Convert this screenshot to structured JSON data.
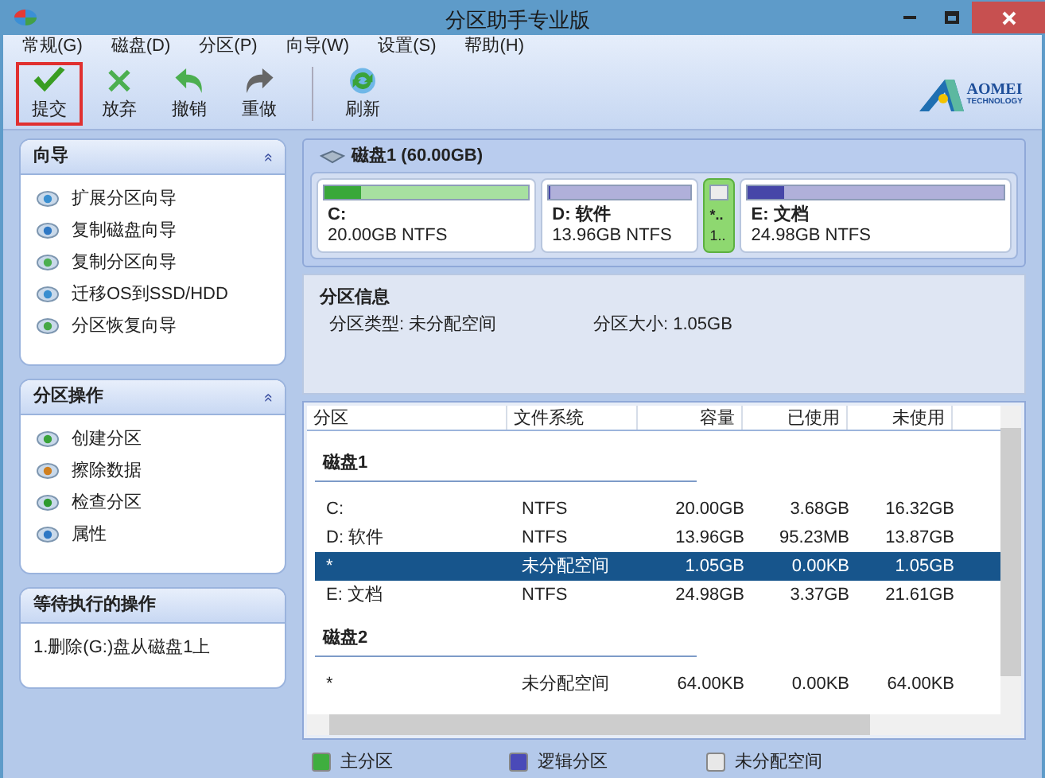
{
  "window": {
    "title": "分区助手专业版"
  },
  "menu": [
    "常规(G)",
    "磁盘(D)",
    "分区(P)",
    "向导(W)",
    "设置(S)",
    "帮助(H)"
  ],
  "toolbar": [
    {
      "label": "提交",
      "kind": "apply",
      "selected": true
    },
    {
      "label": "放弃",
      "kind": "discard",
      "selected": false
    },
    {
      "label": "撤销",
      "kind": "undo",
      "selected": false
    },
    {
      "label": "重做",
      "kind": "redo",
      "selected": false
    },
    {
      "label": "刷新",
      "kind": "refresh",
      "selected": false
    }
  ],
  "logo": {
    "name": "AOMEI",
    "tagline": "TECHNOLOGY"
  },
  "sidebar": [
    {
      "title": "向导",
      "collapse": "«",
      "items": [
        {
          "label": "扩展分区向导",
          "kind": "extend"
        },
        {
          "label": "复制磁盘向导",
          "kind": "copydisk"
        },
        {
          "label": "复制分区向导",
          "kind": "copypart"
        },
        {
          "label": "迁移OS到SSD/HDD",
          "kind": "migrate"
        },
        {
          "label": "分区恢复向导",
          "kind": "recover"
        }
      ]
    },
    {
      "title": "分区操作",
      "collapse": "«",
      "items": [
        {
          "label": "创建分区",
          "kind": "create"
        },
        {
          "label": "擦除数据",
          "kind": "wipe"
        },
        {
          "label": "检查分区",
          "kind": "check"
        },
        {
          "label": "属性",
          "kind": "info"
        }
      ]
    },
    {
      "title": "等待执行的操作",
      "items": [
        {
          "label": "1.删除(G:)盘从磁盘1上",
          "kind": "text"
        }
      ]
    }
  ],
  "disk_map": {
    "title": "磁盘1 (60.00GB)",
    "partitions": [
      {
        "name": "C:",
        "detail": "20.00GB NTFS",
        "kind": "primary",
        "level": 0.18,
        "selected": false
      },
      {
        "name": "D: 软件",
        "detail": "13.96GB NTFS",
        "kind": "logical",
        "level": 0.01,
        "selected": false
      },
      {
        "name": "*..",
        "detail": "1..",
        "kind": "unallocated",
        "selected": true
      },
      {
        "name": "E: 文档",
        "detail": "24.98GB NTFS",
        "kind": "logical",
        "level": 0.14,
        "selected": false
      }
    ]
  },
  "partition_info": {
    "title": "分区信息",
    "type": "分区类型: 未分配空间",
    "size": "分区大小: 1.05GB"
  },
  "table": {
    "columns": [
      "分区",
      "文件系统",
      "容量",
      "已使用",
      "未使用"
    ],
    "groups": [
      {
        "name": "磁盘1",
        "rows": [
          {
            "cells": [
              "C:",
              "NTFS",
              "20.00GB",
              "3.68GB",
              "16.32GB"
            ],
            "selected": false
          },
          {
            "cells": [
              "D: 软件",
              "NTFS",
              "13.96GB",
              "95.23MB",
              "13.87GB"
            ],
            "selected": false
          },
          {
            "cells": [
              "*",
              "未分配空间",
              "1.05GB",
              "0.00KB",
              "1.05GB"
            ],
            "selected": true
          },
          {
            "cells": [
              "E: 文档",
              "NTFS",
              "24.98GB",
              "3.37GB",
              "21.61GB"
            ],
            "selected": false
          }
        ]
      },
      {
        "name": "磁盘2",
        "rows": [
          {
            "cells": [
              "*",
              "未分配空间",
              "64.00KB",
              "0.00KB",
              "64.00KB"
            ],
            "selected": false
          }
        ]
      }
    ]
  },
  "legend": [
    {
      "label": "主分区",
      "color": "#3fae3f"
    },
    {
      "label": "逻辑分区",
      "color": "#4a4ab8"
    },
    {
      "label": "未分配空间",
      "color": "#e8e8e8"
    }
  ]
}
